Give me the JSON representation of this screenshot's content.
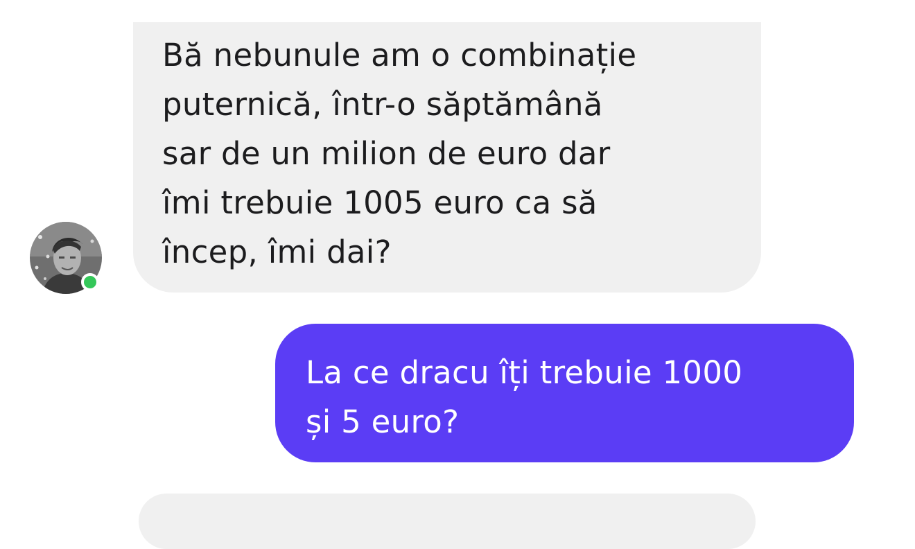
{
  "messages": [
    {
      "sender": "contact",
      "lines": [
        "Bă nebunule am o combinație",
        "puternică, într-o săptămână",
        "sar de un milion de euro dar",
        "îmi trebuie 1005 euro ca să",
        "încep, îmi dai?"
      ]
    },
    {
      "sender": "me",
      "lines": [
        "La ce dracu îți trebuie 1000",
        "și 5 euro?"
      ]
    },
    {
      "sender": "contact",
      "lines": []
    }
  ],
  "colors": {
    "incoming_bubble": "#f0f0f0",
    "outgoing_bubble": "#5b3df5",
    "online_status": "#34c759"
  },
  "contact": {
    "status": "online"
  }
}
